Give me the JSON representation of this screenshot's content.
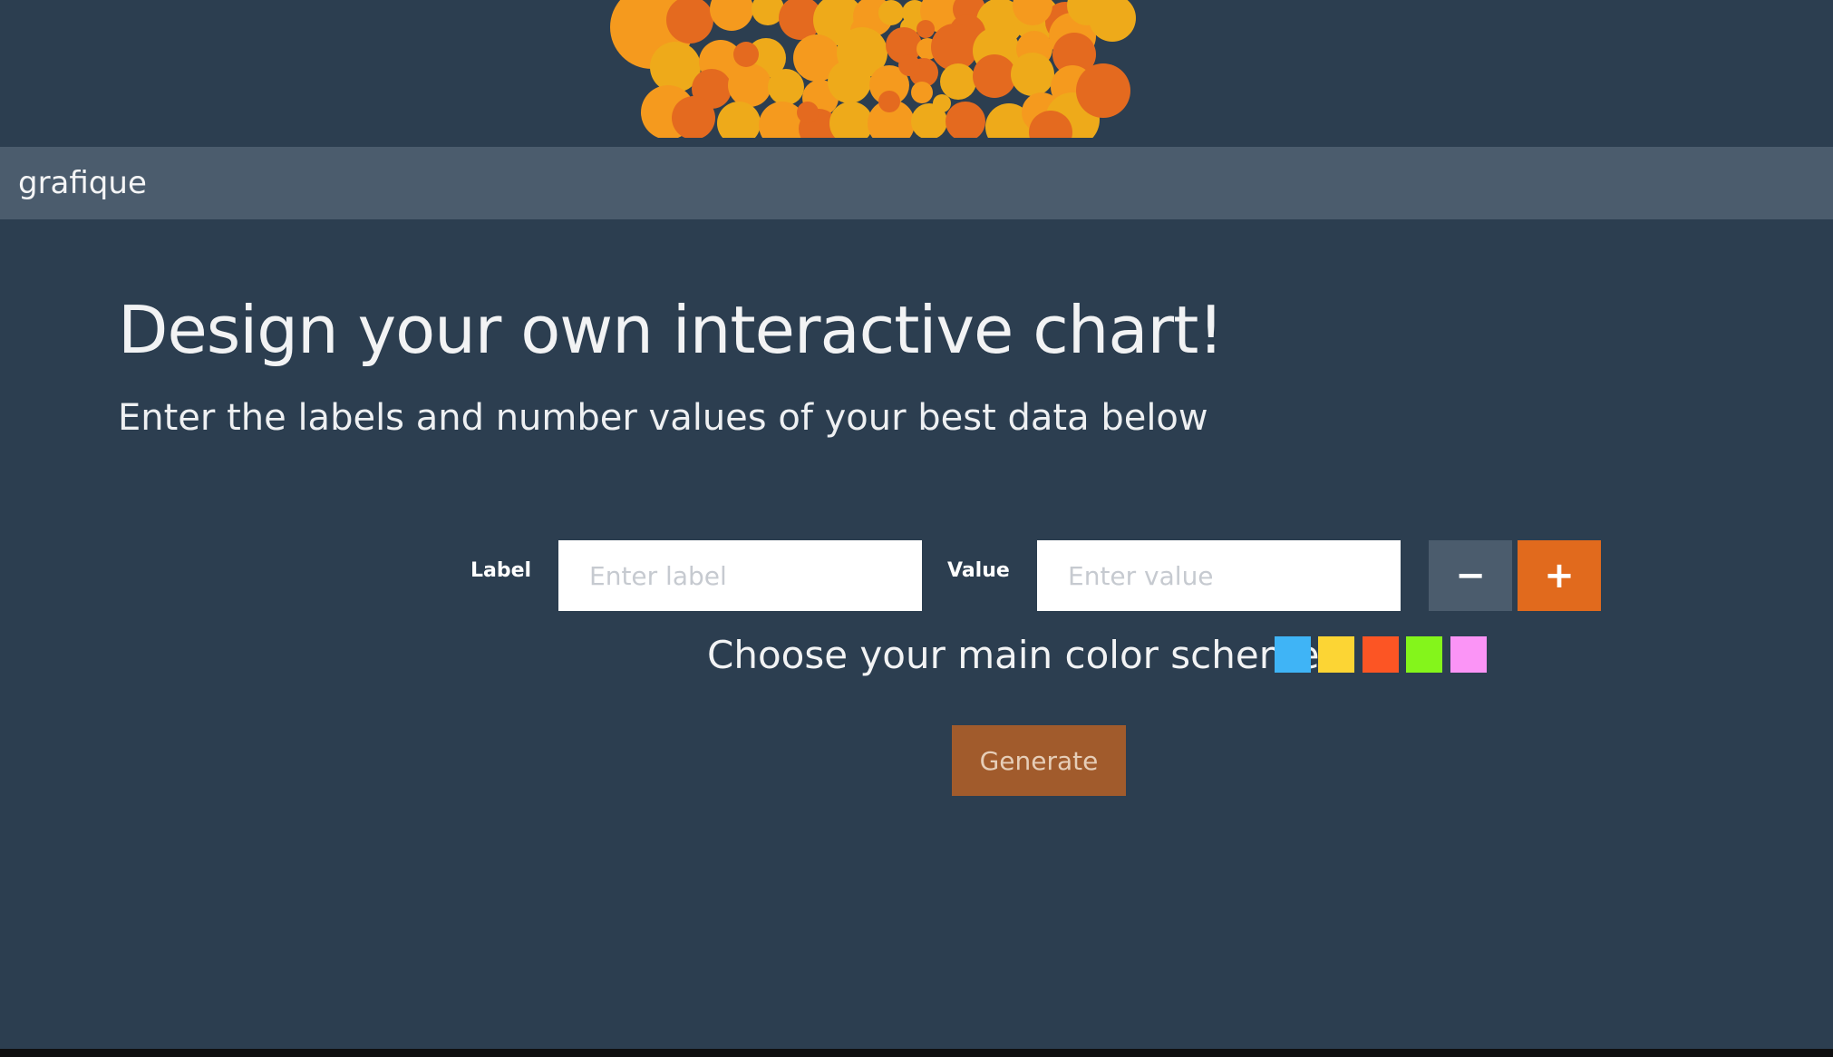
{
  "brand": "grafique",
  "hero": {
    "colors": [
      "#f59a1e",
      "#e46a1f",
      "#eeaa1a"
    ]
  },
  "main": {
    "title": "Design your own interactive chart!",
    "subtitle": "Enter the labels and number values of your best data below"
  },
  "form": {
    "label_text": "Label",
    "label_placeholder": "Enter label",
    "value_text": "Value",
    "value_placeholder": "Enter value",
    "minus_label": "−",
    "plus_label": "+"
  },
  "scheme": {
    "text": "Choose your main color scheme:",
    "colors": [
      "#3fb4f6",
      "#fcd534",
      "#fc5524",
      "#84f51b",
      "#fb94f6"
    ]
  },
  "generate_label": "Generate",
  "colors": {
    "background": "#2c3e50",
    "navbar": "#4b5c6d",
    "minus_button": "#4b5c6d",
    "plus_button": "#e16a1d",
    "generate_button": "#a15b2c"
  }
}
